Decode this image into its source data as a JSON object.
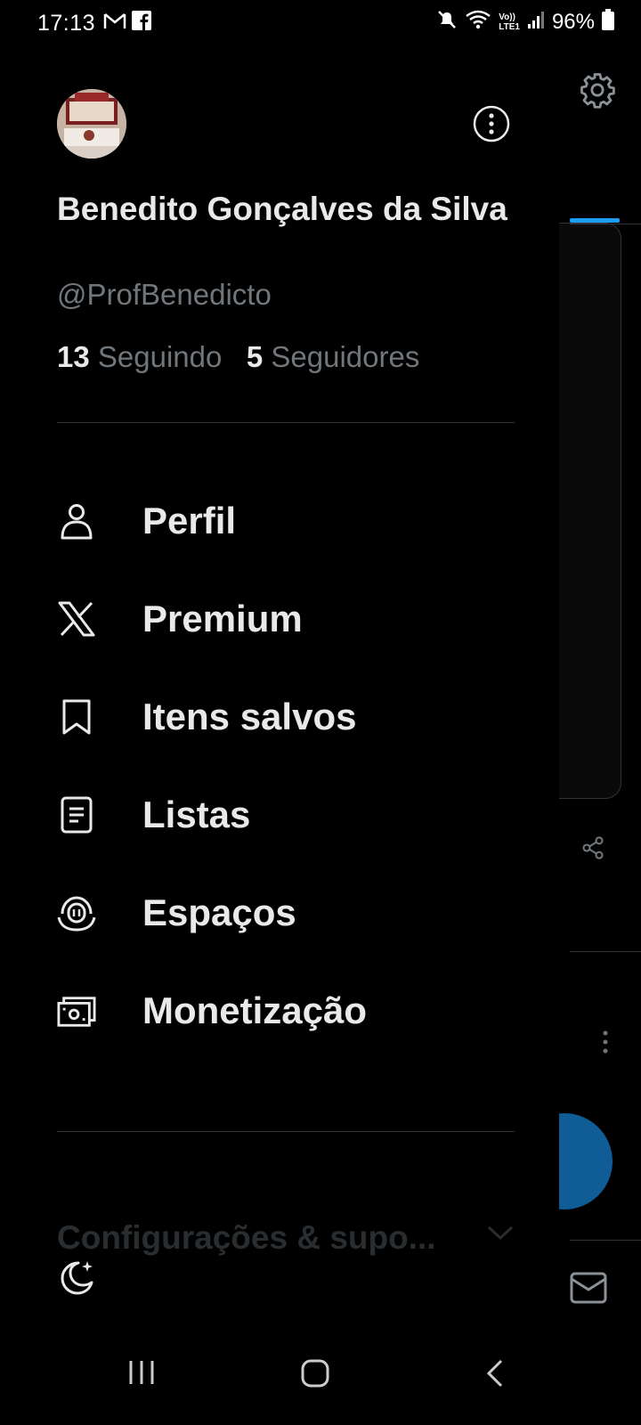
{
  "status_bar": {
    "time": "17:13",
    "left_icons": [
      "gmail-icon",
      "facebook-icon"
    ],
    "right_icons": [
      "mute-icon",
      "wifi-icon",
      "volte-icon",
      "signal-icon",
      "battery-icon"
    ],
    "volte_text": "Vo))\nLTE1",
    "battery_percent": "96%"
  },
  "drawer": {
    "profile": {
      "name": "Benedito Gonçalves da Silva",
      "handle": "@ProfBenedicto",
      "following_count": "13",
      "following_label": "Seguindo",
      "followers_count": "5",
      "followers_label": "Seguidores"
    },
    "menu": [
      {
        "label": "Perfil",
        "icon": "person-icon"
      },
      {
        "label": "Premium",
        "icon": "x-logo-icon"
      },
      {
        "label": "Itens salvos",
        "icon": "bookmark-icon"
      },
      {
        "label": "Listas",
        "icon": "list-icon"
      },
      {
        "label": "Espaços",
        "icon": "spaces-icon"
      },
      {
        "label": "Monetização",
        "icon": "money-icon"
      }
    ],
    "settings_label": "Configurações & supo...",
    "night_mode_icon": "moon-icon"
  },
  "background": {
    "icons": [
      "gear-icon",
      "share-icon",
      "more-vertical-icon",
      "mail-icon"
    ],
    "accent": "#1d9bf0"
  },
  "nav_bar": {
    "buttons": [
      "recent-apps-icon",
      "home-icon",
      "back-icon"
    ]
  }
}
